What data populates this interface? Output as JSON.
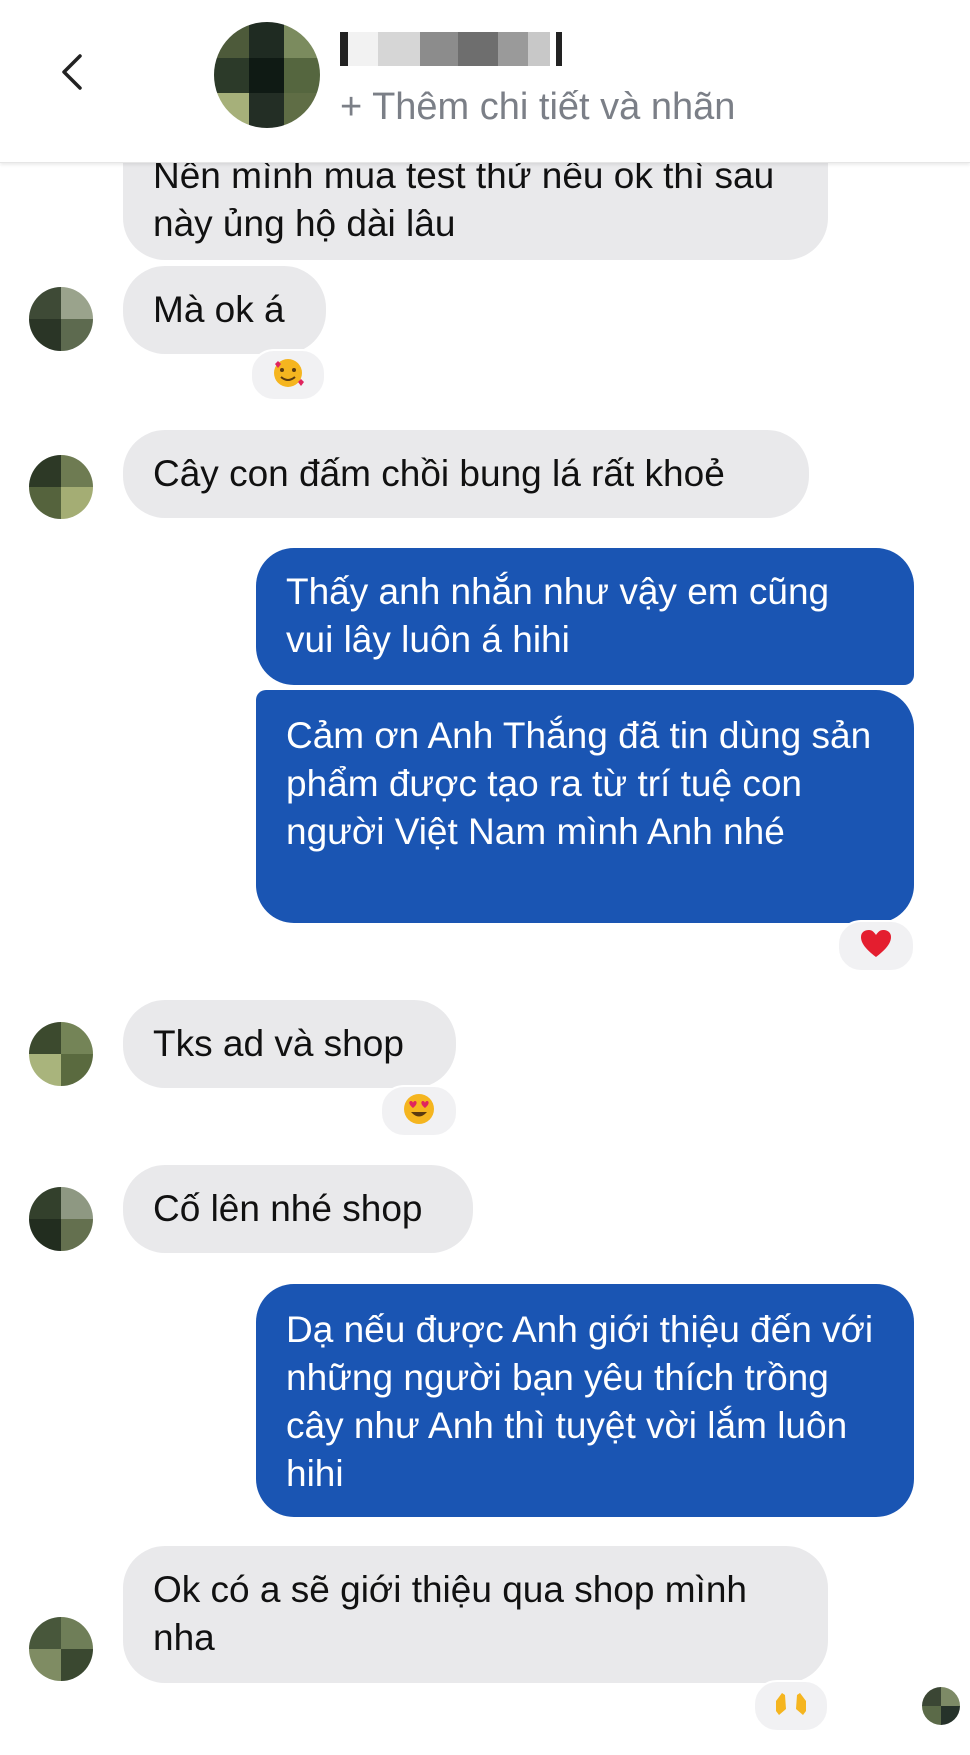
{
  "header": {
    "back_icon": "chevron-left-icon",
    "subtitle": "+ Thêm chi tiết và nhãn"
  },
  "messages": [
    {
      "side": "in",
      "text": "Nên mình mua test thử nếu ok thì sau này ủng hộ dài lâu"
    },
    {
      "side": "in",
      "text": "Mà ok á",
      "reaction": "smiling-face-with-hearts"
    },
    {
      "side": "in",
      "text": "Cây con đấm chồi bung lá rất khoẻ"
    },
    {
      "side": "out",
      "text": "Thấy anh nhắn như vậy em cũng vui lây luôn á hihi"
    },
    {
      "side": "out",
      "text": "Cảm ơn Anh Thắng đã tin dùng sản phẩm được tạo ra từ trí tuệ con người Việt Nam mình Anh nhé",
      "reaction": "red-heart"
    },
    {
      "side": "in",
      "text": "Tks ad và shop",
      "reaction": "heart-eyes"
    },
    {
      "side": "in",
      "text": "Cố lên nhé shop"
    },
    {
      "side": "out",
      "text": "Dạ nếu được Anh giới thiệu đến với những người bạn yêu thích trồng cây như Anh thì tuyệt vời lắm luôn hihi"
    },
    {
      "side": "in",
      "text": "Ok có a sẽ giới thiệu qua shop mình nha",
      "reaction": "raising-hands"
    }
  ],
  "colors": {
    "outgoing_bubble": "#1a55b3",
    "incoming_bubble": "#e9e9eb",
    "subtitle_text": "#7b7f87"
  }
}
